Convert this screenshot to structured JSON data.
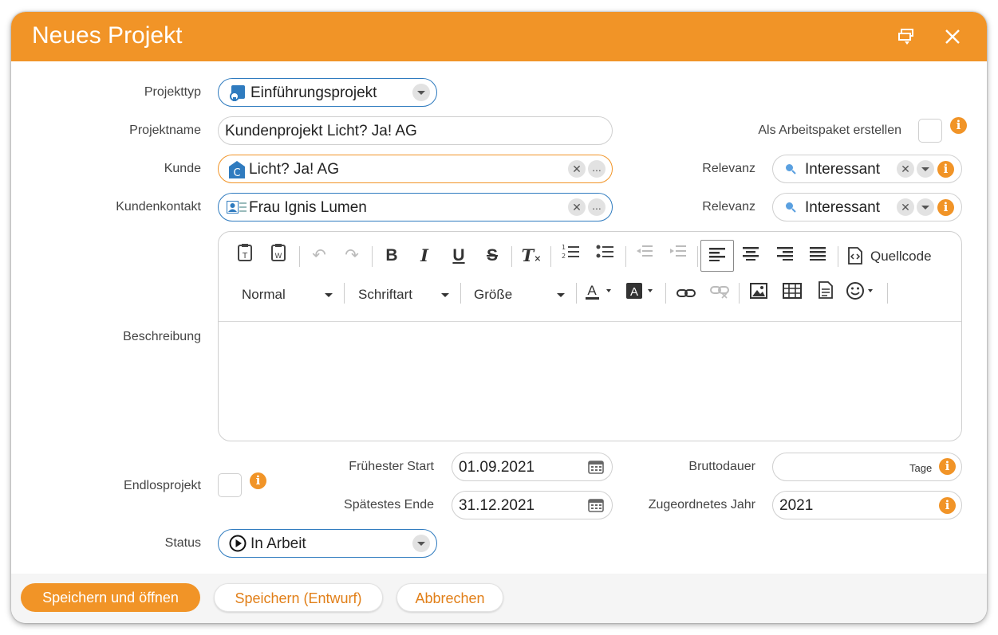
{
  "dialog": {
    "title": "Neues Projekt"
  },
  "form": {
    "projekttyp": {
      "label": "Projekttyp",
      "value": "Einführungsprojekt"
    },
    "projektname": {
      "label": "Projektname",
      "value": "Kundenprojekt Licht? Ja! AG"
    },
    "arbeitspaket": {
      "label": "Als Arbeitspaket erstellen",
      "checked": false
    },
    "kunde": {
      "label": "Kunde",
      "value": "Licht? Ja! AG",
      "more": "..."
    },
    "relevanz1": {
      "label": "Relevanz",
      "value": "Interessant"
    },
    "kundenkontakt": {
      "label": "Kundenkontakt",
      "value": "Frau Ignis Lumen",
      "more": "..."
    },
    "relevanz2": {
      "label": "Relevanz",
      "value": "Interessant"
    },
    "beschreibung": {
      "label": "Beschreibung",
      "source_label": "Quellcode",
      "format": "Normal",
      "font": "Schriftart",
      "size": "Größe",
      "text": ""
    },
    "endlosprojekt": {
      "label": "Endlosprojekt",
      "checked": false
    },
    "fruehester_start": {
      "label": "Frühester Start",
      "value": "01.09.2021"
    },
    "spaetestes_ende": {
      "label": "Spätestes Ende",
      "value": "31.12.2021"
    },
    "bruttodauer": {
      "label": "Bruttodauer",
      "value": "",
      "unit": "Tage"
    },
    "zugeordnetes_jahr": {
      "label": "Zugeordnetes Jahr",
      "value": "2021"
    },
    "status": {
      "label": "Status",
      "value": "In Arbeit"
    }
  },
  "footer": {
    "save_open": "Speichern und öffnen",
    "save_draft": "Speichern (Entwurf)",
    "cancel": "Abbrechen"
  },
  "colors": {
    "accent": "#f19427",
    "field_blue": "#2f7bbf",
    "info": "#f19427"
  }
}
